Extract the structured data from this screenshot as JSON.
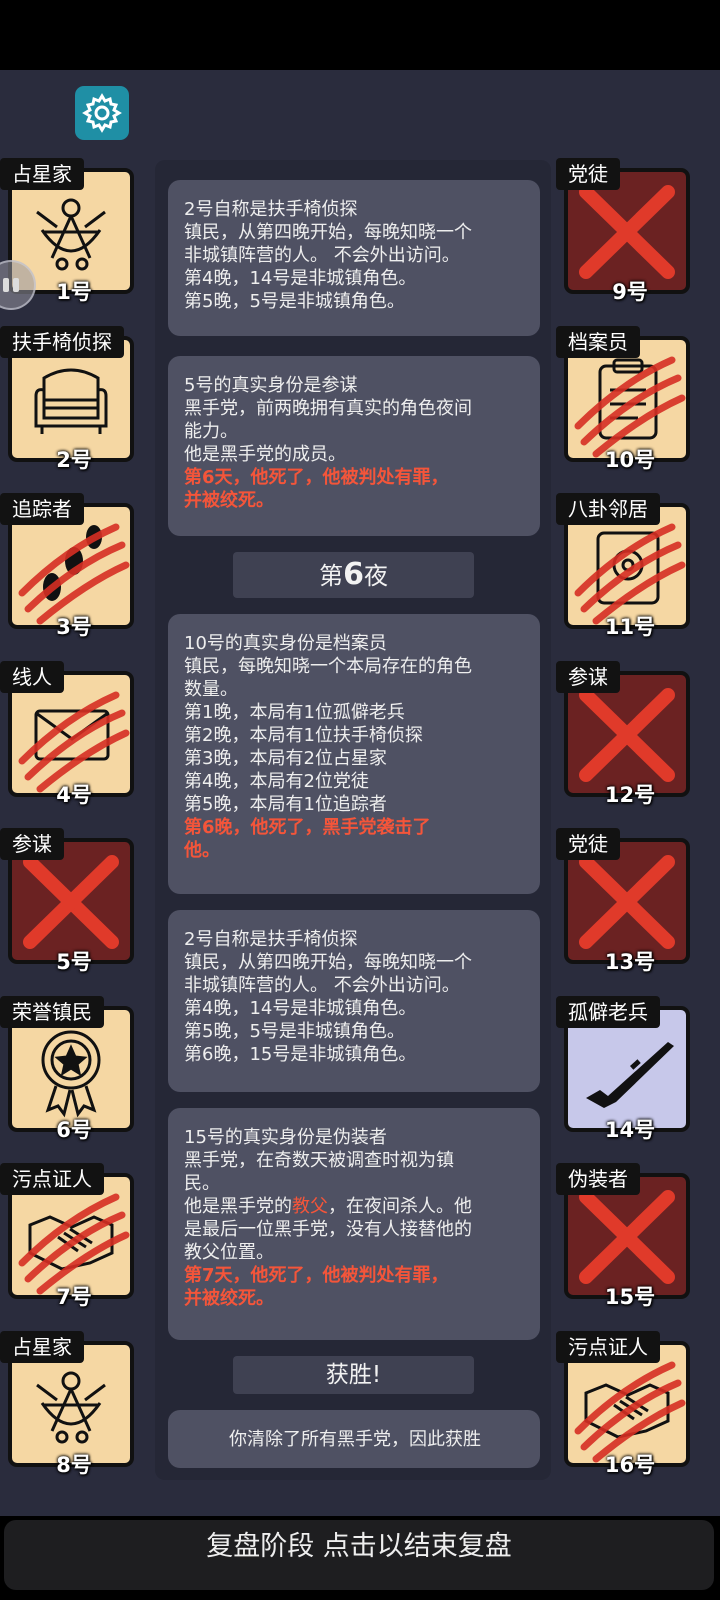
{
  "left_players": [
    {
      "role": "占星家",
      "number": "1号",
      "dead": false,
      "art": "sextant"
    },
    {
      "role": "扶手椅侦探",
      "number": "2号",
      "dead": false,
      "art": "armchair"
    },
    {
      "role": "追踪者",
      "number": "3号",
      "dead": false,
      "art": "footprints",
      "claws": true
    },
    {
      "role": "线人",
      "number": "4号",
      "dead": false,
      "art": "envelope",
      "claws": true
    },
    {
      "role": "参谋",
      "number": "5号",
      "dead": true,
      "art": "cross"
    },
    {
      "role": "荣誉镇民",
      "number": "6号",
      "dead": false,
      "art": "medal"
    },
    {
      "role": "污点证人",
      "number": "7号",
      "dead": false,
      "art": "handshake",
      "claws": true
    },
    {
      "role": "占星家",
      "number": "8号",
      "dead": false,
      "art": "sextant"
    }
  ],
  "right_players": [
    {
      "role": "党徒",
      "number": "9号",
      "dead": true,
      "art": "cross"
    },
    {
      "role": "档案员",
      "number": "10号",
      "dead": false,
      "art": "clipboard",
      "claws": true
    },
    {
      "role": "八卦邻居",
      "number": "11号",
      "dead": false,
      "art": "gossip",
      "claws": true
    },
    {
      "role": "参谋",
      "number": "12号",
      "dead": true,
      "art": "cross"
    },
    {
      "role": "党徒",
      "number": "13号",
      "dead": true,
      "art": "cross"
    },
    {
      "role": "孤僻老兵",
      "number": "14号",
      "dead": false,
      "art": "rifle"
    },
    {
      "role": "伪装者",
      "number": "15号",
      "dead": true,
      "art": "cross"
    },
    {
      "role": "污点证人",
      "number": "16号",
      "dead": false,
      "art": "handshake",
      "claws": true
    }
  ],
  "messages": [
    {
      "lines": [
        "2号自称是扶手椅侦探",
        "镇民，从第四晚开始，每晚知晓一个",
        "非城镇阵营的人。 不会外出访问。",
        "第4晚，14号是非城镇角色。",
        "第5晚，5号是非城镇角色。"
      ]
    },
    {
      "lines": [
        "5号的真实身份是参谋",
        "黑手党，前两晚拥有真实的角色夜间",
        "能力。",
        "他是黑手党的成员。"
      ],
      "red_lines": [
        "第6天，他死了，他被判处有罪，",
        "并被绞死。"
      ]
    },
    {
      "lines": [
        "10号的真实身份是档案员",
        "镇民，每晚知晓一个本局存在的角色",
        "数量。",
        "第1晚，本局有1位孤僻老兵",
        "第2晚，本局有1位扶手椅侦探",
        "第3晚，本局有2位占星家",
        "第4晚，本局有2位党徒",
        "第5晚，本局有1位追踪者"
      ],
      "red_lines": [
        "第6晚，他死了，黑手党袭击了",
        "他。"
      ]
    },
    {
      "lines": [
        "2号自称是扶手椅侦探",
        "镇民，从第四晚开始，每晚知晓一个",
        "非城镇阵营的人。 不会外出访问。",
        "第4晚，14号是非城镇角色。",
        "第5晚，5号是非城镇角色。",
        "第6晚，15号是非城镇角色。"
      ]
    },
    {
      "lines": [
        "15号的真实身份是伪装者",
        "黑手党，在奇数天被调查时视为镇",
        "民。"
      ],
      "mixed": {
        "pre": "他是黑手党的",
        "em": "教父",
        "post": "，在夜间杀人。他"
      },
      "lines_after": [
        "是最后一位黑手党，没有人接替他的",
        "教父位置。"
      ],
      "red_lines": [
        "第7天，他死了，他被判处有罪，",
        "并被绞死。"
      ]
    },
    {
      "lines": [
        "你清除了所有黑手党，因此获胜"
      ]
    }
  ],
  "night_divider": {
    "pre": "第",
    "num": "6",
    "post": "夜"
  },
  "victory_divider": "获胜!",
  "bottom_bar": "复盘阶段 点击以结束复盘",
  "colors": {
    "accent_red": "#f4553a",
    "card_bg": "#f5d7a3",
    "dead_bg": "#6b2222",
    "gear_teal": "#1f8fa5"
  }
}
